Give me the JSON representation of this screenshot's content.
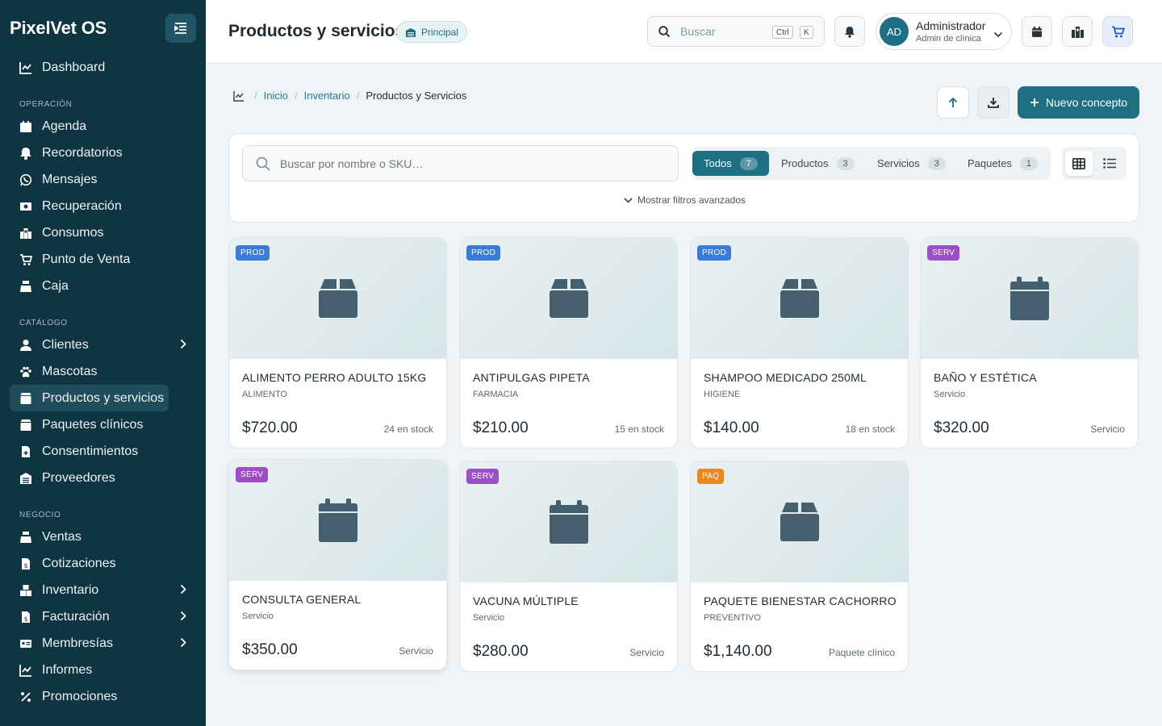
{
  "app": {
    "brand": "PixelVet OS"
  },
  "sidebar": {
    "top_item": "Dashboard",
    "sections": [
      {
        "title": "OPERACIÓN",
        "items": [
          "Agenda",
          "Recordatorios",
          "Mensajes",
          "Recuperación",
          "Consumos",
          "Punto de Venta",
          "Caja"
        ]
      },
      {
        "title": "CATÁLOGO",
        "items": [
          "Clientes",
          "Mascotas",
          "Productos y servicios",
          "Paquetes clínicos",
          "Consentimientos",
          "Proveedores"
        ]
      },
      {
        "title": "NEGOCIO",
        "items": [
          "Ventas",
          "Cotizaciones",
          "Inventario",
          "Facturación",
          "Membresías",
          "Informes",
          "Promociones"
        ]
      }
    ],
    "active_item": "Productos y servicios"
  },
  "header": {
    "title": "Productos y servicios",
    "scope_badge": "Principal",
    "search_placeholder": "Buscar",
    "shortcut_keys": [
      "Ctrl",
      "K"
    ],
    "user": {
      "initials": "AD",
      "name": "Administrador",
      "role": "Admin de clínica"
    }
  },
  "breadcrumb": {
    "items": [
      "Inicio",
      "Inventario"
    ],
    "current": "Productos y Servicios"
  },
  "actions": {
    "new_label": "Nuevo concepto"
  },
  "filters": {
    "search_placeholder": "Buscar por nombre o SKU…",
    "segments": [
      {
        "label": "Todos",
        "count": "7"
      },
      {
        "label": "Productos",
        "count": "3"
      },
      {
        "label": "Servicios",
        "count": "3"
      },
      {
        "label": "Paquetes",
        "count": "1"
      }
    ],
    "active_segment": "Todos",
    "advanced_label": "Mostrar filtros avanzados"
  },
  "colors": {
    "sidebar": "#0f3442",
    "accent": "#1f6f82",
    "prod_tag": "#3a7bd5",
    "serv_tag": "#9b4fc4",
    "paq_tag": "#e88a1e"
  },
  "products": [
    {
      "tag": "PROD",
      "name": "ALIMENTO PERRO ADULTO 15KG",
      "category": "ALIMENTO",
      "price": "$720.00",
      "stock": "24 en stock",
      "icon": "box-icon"
    },
    {
      "tag": "PROD",
      "name": "ANTIPULGAS PIPETA",
      "category": "FARMACIA",
      "price": "$210.00",
      "stock": "15 en stock",
      "icon": "box-icon"
    },
    {
      "tag": "PROD",
      "name": "SHAMPOO MEDICADO 250ML",
      "category": "HIGIENE",
      "price": "$140.00",
      "stock": "18 en stock",
      "icon": "box-icon"
    },
    {
      "tag": "SERV",
      "name": "BAÑO Y ESTÉTICA",
      "category": "Servicio",
      "price": "$320.00",
      "stock": "Servicio",
      "icon": "calendar-icon"
    },
    {
      "tag": "SERV",
      "name": "CONSULTA GENERAL",
      "category": "Servicio",
      "price": "$350.00",
      "stock": "Servicio",
      "icon": "calendar-icon"
    },
    {
      "tag": "SERV",
      "name": "VACUNA MÚLTIPLE",
      "category": "Servicio",
      "price": "$280.00",
      "stock": "Servicio",
      "icon": "calendar-icon"
    },
    {
      "tag": "PAQ",
      "name": "PAQUETE BIENESTAR CACHORRO",
      "category": "PREVENTIVO",
      "price": "$1,140.00",
      "stock": "Paquete clínico",
      "icon": "box-icon"
    }
  ]
}
